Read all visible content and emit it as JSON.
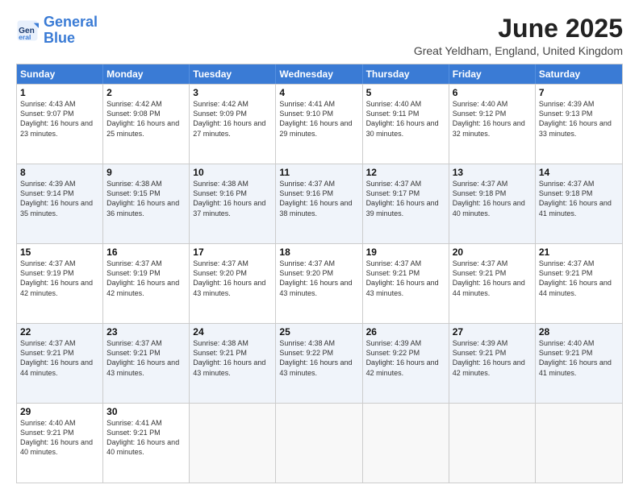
{
  "logo": {
    "general": "General",
    "blue": "Blue"
  },
  "title": "June 2025",
  "location": "Great Yeldham, England, United Kingdom",
  "days": [
    "Sunday",
    "Monday",
    "Tuesday",
    "Wednesday",
    "Thursday",
    "Friday",
    "Saturday"
  ],
  "weeks": [
    [
      {
        "day": "1",
        "sunrise": "4:43 AM",
        "sunset": "9:07 PM",
        "daylight": "16 hours and 23 minutes."
      },
      {
        "day": "2",
        "sunrise": "4:42 AM",
        "sunset": "9:08 PM",
        "daylight": "16 hours and 25 minutes."
      },
      {
        "day": "3",
        "sunrise": "4:42 AM",
        "sunset": "9:09 PM",
        "daylight": "16 hours and 27 minutes."
      },
      {
        "day": "4",
        "sunrise": "4:41 AM",
        "sunset": "9:10 PM",
        "daylight": "16 hours and 29 minutes."
      },
      {
        "day": "5",
        "sunrise": "4:40 AM",
        "sunset": "9:11 PM",
        "daylight": "16 hours and 30 minutes."
      },
      {
        "day": "6",
        "sunrise": "4:40 AM",
        "sunset": "9:12 PM",
        "daylight": "16 hours and 32 minutes."
      },
      {
        "day": "7",
        "sunrise": "4:39 AM",
        "sunset": "9:13 PM",
        "daylight": "16 hours and 33 minutes."
      }
    ],
    [
      {
        "day": "8",
        "sunrise": "4:39 AM",
        "sunset": "9:14 PM",
        "daylight": "16 hours and 35 minutes."
      },
      {
        "day": "9",
        "sunrise": "4:38 AM",
        "sunset": "9:15 PM",
        "daylight": "16 hours and 36 minutes."
      },
      {
        "day": "10",
        "sunrise": "4:38 AM",
        "sunset": "9:16 PM",
        "daylight": "16 hours and 37 minutes."
      },
      {
        "day": "11",
        "sunrise": "4:37 AM",
        "sunset": "9:16 PM",
        "daylight": "16 hours and 38 minutes."
      },
      {
        "day": "12",
        "sunrise": "4:37 AM",
        "sunset": "9:17 PM",
        "daylight": "16 hours and 39 minutes."
      },
      {
        "day": "13",
        "sunrise": "4:37 AM",
        "sunset": "9:18 PM",
        "daylight": "16 hours and 40 minutes."
      },
      {
        "day": "14",
        "sunrise": "4:37 AM",
        "sunset": "9:18 PM",
        "daylight": "16 hours and 41 minutes."
      }
    ],
    [
      {
        "day": "15",
        "sunrise": "4:37 AM",
        "sunset": "9:19 PM",
        "daylight": "16 hours and 42 minutes."
      },
      {
        "day": "16",
        "sunrise": "4:37 AM",
        "sunset": "9:19 PM",
        "daylight": "16 hours and 42 minutes."
      },
      {
        "day": "17",
        "sunrise": "4:37 AM",
        "sunset": "9:20 PM",
        "daylight": "16 hours and 43 minutes."
      },
      {
        "day": "18",
        "sunrise": "4:37 AM",
        "sunset": "9:20 PM",
        "daylight": "16 hours and 43 minutes."
      },
      {
        "day": "19",
        "sunrise": "4:37 AM",
        "sunset": "9:21 PM",
        "daylight": "16 hours and 43 minutes."
      },
      {
        "day": "20",
        "sunrise": "4:37 AM",
        "sunset": "9:21 PM",
        "daylight": "16 hours and 44 minutes."
      },
      {
        "day": "21",
        "sunrise": "4:37 AM",
        "sunset": "9:21 PM",
        "daylight": "16 hours and 44 minutes."
      }
    ],
    [
      {
        "day": "22",
        "sunrise": "4:37 AM",
        "sunset": "9:21 PM",
        "daylight": "16 hours and 44 minutes."
      },
      {
        "day": "23",
        "sunrise": "4:37 AM",
        "sunset": "9:21 PM",
        "daylight": "16 hours and 43 minutes."
      },
      {
        "day": "24",
        "sunrise": "4:38 AM",
        "sunset": "9:21 PM",
        "daylight": "16 hours and 43 minutes."
      },
      {
        "day": "25",
        "sunrise": "4:38 AM",
        "sunset": "9:22 PM",
        "daylight": "16 hours and 43 minutes."
      },
      {
        "day": "26",
        "sunrise": "4:39 AM",
        "sunset": "9:22 PM",
        "daylight": "16 hours and 42 minutes."
      },
      {
        "day": "27",
        "sunrise": "4:39 AM",
        "sunset": "9:21 PM",
        "daylight": "16 hours and 42 minutes."
      },
      {
        "day": "28",
        "sunrise": "4:40 AM",
        "sunset": "9:21 PM",
        "daylight": "16 hours and 41 minutes."
      }
    ],
    [
      {
        "day": "29",
        "sunrise": "4:40 AM",
        "sunset": "9:21 PM",
        "daylight": "16 hours and 40 minutes."
      },
      {
        "day": "30",
        "sunrise": "4:41 AM",
        "sunset": "9:21 PM",
        "daylight": "16 hours and 40 minutes."
      },
      null,
      null,
      null,
      null,
      null
    ]
  ]
}
